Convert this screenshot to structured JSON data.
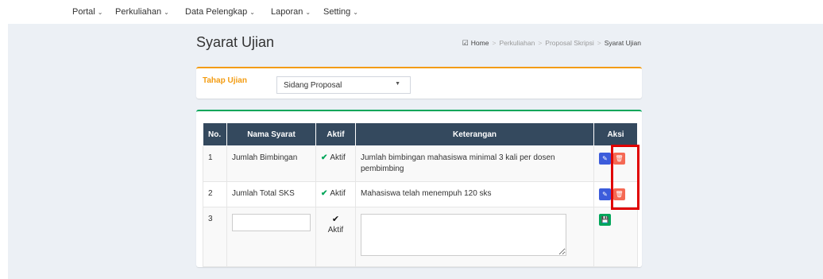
{
  "nav": {
    "items": [
      {
        "label": "Portal",
        "icon": "chevron-down-icon"
      },
      {
        "label": "Perkuliahan",
        "icon": "chevron-down-icon"
      },
      {
        "label": "Data Pelengkap",
        "icon": "chevron-down-icon"
      },
      {
        "label": "Laporan",
        "icon": "chevron-down-icon"
      },
      {
        "label": "Setting",
        "icon": "chevron-down-icon"
      }
    ]
  },
  "page": {
    "title": "Syarat Ujian",
    "breadcrumb": {
      "home": "Home",
      "items": [
        "Perkuliahan",
        "Proposal Skripsi"
      ],
      "active": "Syarat Ujian"
    }
  },
  "filter": {
    "label": "Tahap Ujian",
    "selected": "Sidang Proposal"
  },
  "table": {
    "headers": [
      "No.",
      "Nama Syarat",
      "Aktif",
      "Keterangan",
      "Aksi"
    ],
    "rows": [
      {
        "no": "1",
        "nama": "Jumlah Bimbingan",
        "aktif": "Aktif",
        "keterangan": "Jumlah bimbingan mahasiswa minimal 3 kali per dosen pembimbing"
      },
      {
        "no": "2",
        "nama": "Jumlah Total SKS",
        "aktif": "Aktif",
        "keterangan": "Mahasiswa telah menempuh 120 sks"
      }
    ],
    "new_row": {
      "no": "3",
      "aktif_label": "Aktif",
      "nama_value": "",
      "keterangan_value": ""
    }
  },
  "colors": {
    "header_bg": "#34495e",
    "accent_orange": "#f39c12",
    "accent_green": "#00a65a",
    "edit_blue": "#3c5cdb",
    "delete_red": "#f56954",
    "highlight_red": "#e00000"
  }
}
